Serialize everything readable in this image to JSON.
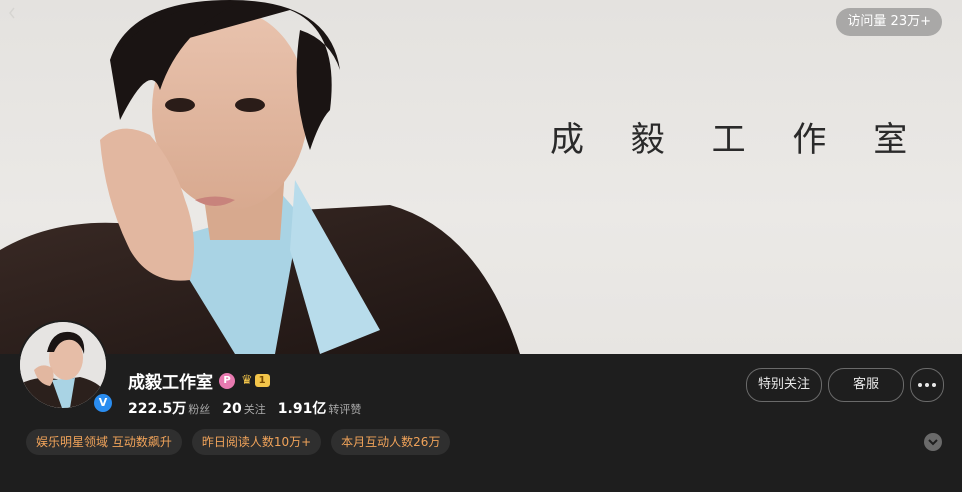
{
  "banner": {
    "title": "成 毅 工 作 室",
    "visit_count": "访问量 23万+"
  },
  "profile": {
    "name": "成毅工作室",
    "vip_badge": "P",
    "level": "1",
    "verified_mark": "V",
    "stats": [
      {
        "value": "222.5万",
        "label": "粉丝"
      },
      {
        "value": "20",
        "label": "关注"
      },
      {
        "value": "1.91亿",
        "label": "转评赞"
      }
    ],
    "buttons": {
      "special_follow": "特别关注",
      "service": "客服"
    },
    "tags": [
      "娱乐明星领域 互动数飙升",
      "昨日阅读人数10万+",
      "本月互动人数26万"
    ],
    "expand_icon": "chevron-down-icon"
  },
  "colors": {
    "background": "#1e1e1e",
    "tag_text": "#f0a35a",
    "verified": "#2a8df0",
    "vip": "#e87ab0",
    "level": "#f3c54a"
  }
}
